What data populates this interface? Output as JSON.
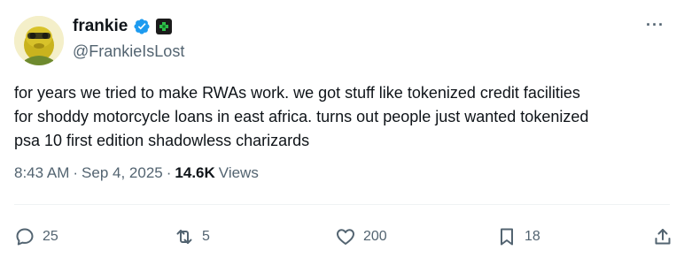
{
  "author": {
    "display_name": "frankie",
    "handle": "@FrankieIsLost",
    "verified_icon": "verified-badge-icon",
    "affiliate_icon": "affiliate-badge-icon"
  },
  "more_label": "···",
  "post": {
    "text": "for years we tried to make RWAs work. we got stuff like tokenized credit facilities\nfor shoddy motorcycle loans in east africa. turns out people just wanted tokenized\npsa 10 first edition shadowless charizards"
  },
  "meta": {
    "time": "8:43 AM",
    "sep1": "·",
    "date": "Sep 4, 2025",
    "sep2": "·",
    "views_count": "14.6K",
    "views_label": "Views"
  },
  "actions": {
    "replies": "25",
    "reposts": "5",
    "likes": "200",
    "bookmarks": "18"
  },
  "colors": {
    "text": "#0f1419",
    "secondary": "#536471",
    "verified_blue": "#1d9bf0",
    "divider": "#eff3f4"
  }
}
